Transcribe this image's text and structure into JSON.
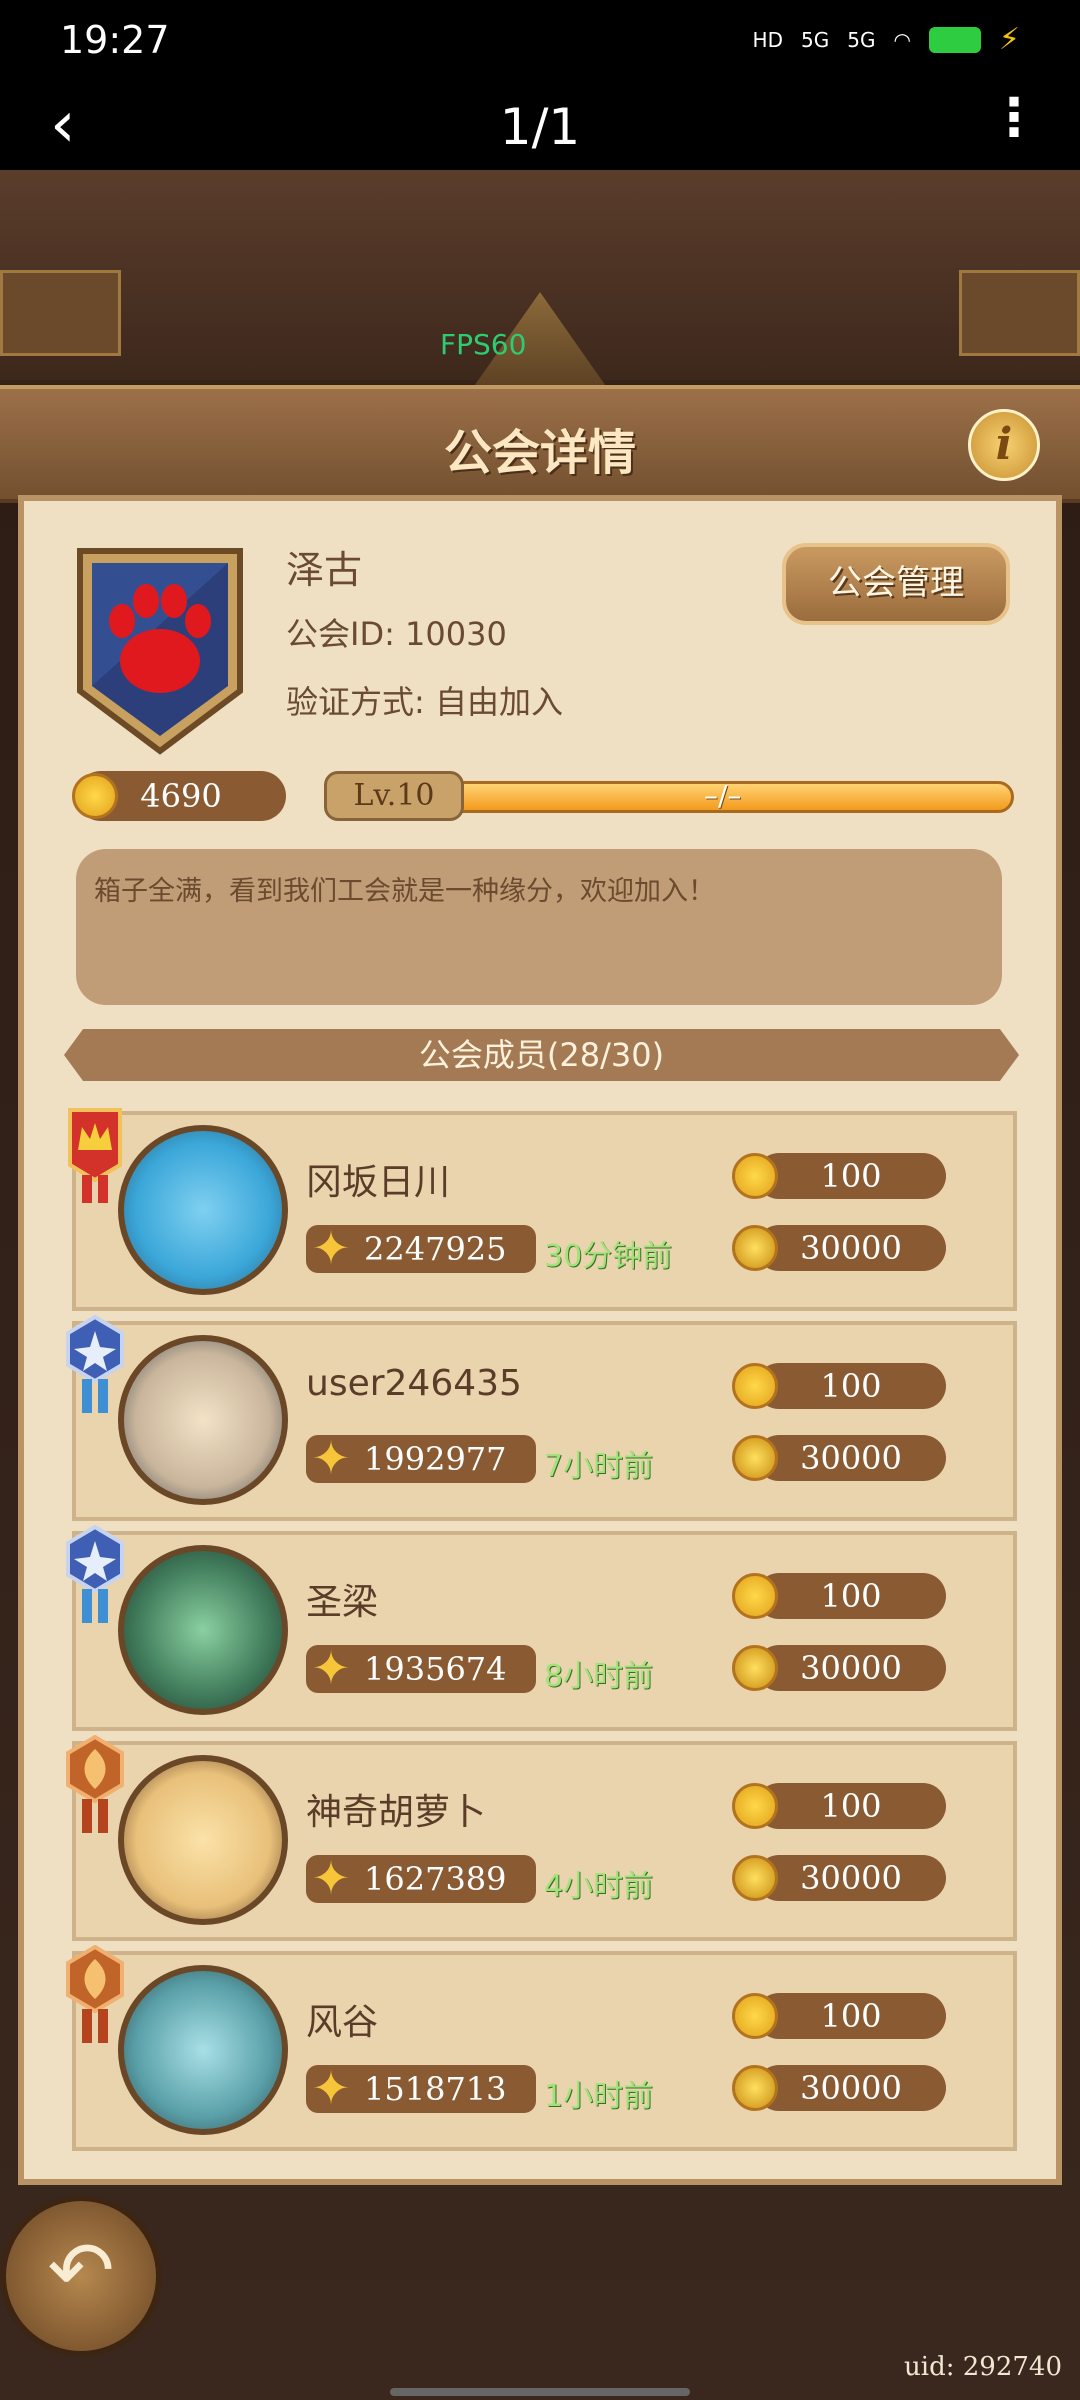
{
  "status": {
    "time": "19:27",
    "network1": "5G",
    "network2": "5G",
    "hd": "HD"
  },
  "nav": {
    "title": "1/1",
    "back_icon": "chevron-left-icon",
    "more_icon": "more-vertical-icon"
  },
  "game": {
    "fps": "FPS60",
    "title": "公会详情",
    "info_label": "i"
  },
  "guild": {
    "name": "泽古",
    "id_text": "公会ID: 10030",
    "verify_text": "验证方式: 自由加入",
    "manage_label": "公会管理",
    "coins": "4690",
    "level": "Lv.10",
    "progress_text": "–/–",
    "description": "箱子全满，看到我们工会就是一种缘分，欢迎加入！",
    "members_header": "公会成员(28/30)"
  },
  "members": [
    {
      "name": "冈坂日川",
      "power": "2247925",
      "time": "30分钟前",
      "contrib": "100",
      "gold": "30000",
      "medal": "crown-medal-icon",
      "medal_color": "#d3322a",
      "avatar_color": "#3ba7d9"
    },
    {
      "name": "user246435",
      "power": "1992977",
      "time": "7小时前",
      "contrib": "100",
      "gold": "30000",
      "medal": "star-medal-icon",
      "medal_color": "#3f5fb5",
      "avatar_color": "#c9b59b"
    },
    {
      "name": "圣梁",
      "power": "1935674",
      "time": "8小时前",
      "contrib": "100",
      "gold": "30000",
      "medal": "star-medal-icon",
      "medal_color": "#3f5fb5",
      "avatar_color": "#3f7a5a"
    },
    {
      "name": "神奇胡萝卜",
      "power": "1627389",
      "time": "4小时前",
      "contrib": "100",
      "gold": "30000",
      "medal": "flame-medal-icon",
      "medal_color": "#c0642a",
      "avatar_color": "#e8c07a"
    },
    {
      "name": "风谷",
      "power": "1518713",
      "time": "1小时前",
      "contrib": "100",
      "gold": "30000",
      "medal": "flame-medal-icon",
      "medal_color": "#c0642a",
      "avatar_color": "#5aa0a8"
    }
  ],
  "footer": {
    "uid": "uid: 292740",
    "back_icon": "return-arrow-icon"
  }
}
